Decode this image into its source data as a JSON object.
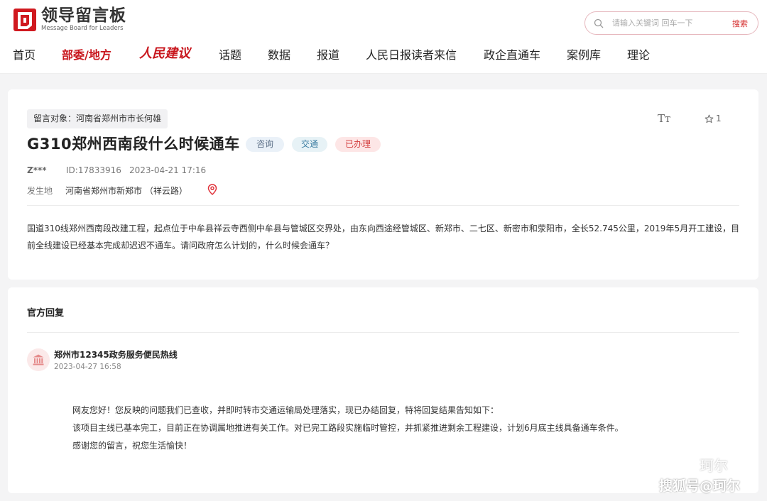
{
  "site": {
    "logo_cn": "领导留言板",
    "logo_en": "Message Board for Leaders"
  },
  "search": {
    "placeholder": "请输入关键词 回车一下",
    "button": "搜索"
  },
  "nav": {
    "items": [
      "首页",
      "部委/地方",
      "人民建议",
      "话题",
      "数据",
      "报道",
      "人民日报读者来信",
      "政企直通车",
      "案例库",
      "理论"
    ],
    "active_index": 1
  },
  "message": {
    "target": "留言对象：河南省郑州市市长何雄",
    "title": "G310郑州西南段什么时候通车",
    "tags": [
      "咨询",
      "交通",
      "已办理"
    ],
    "font_tool": "Tт",
    "favorite_count": "1",
    "user": "Z***",
    "id": "ID:17833916",
    "date": "2023-04-21 17:16",
    "location_label": "发生地",
    "location": "河南省郑州市新郑市 （祥云路）",
    "content": "国道310线郑州西南段改建工程，起点位于中牟县祥云寺西侧中牟县与管城区交界处，由东向西途经管城区、新郑市、二七区、新密市和荥阳市，全长52.745公里，2019年5月开工建设，目前全线建设已经基本完成却迟迟不通车。请问政府怎么计划的，什么时候会通车？"
  },
  "reply": {
    "section_title": "官方回复",
    "org": "郑州市12345政务服务便民热线",
    "date": "2023-04-27 16:58",
    "lines": [
      "网友您好！您反映的问题我们已查收，并即时转市交通运输局处理落实，现已办结回复，特将回复结果告知如下：",
      "该项目主线已基本完工，目前正在协调属地推进有关工作。对已完工路段实施临时管控，并抓紧推进剩余工程建设，计划6月底主线具备通车条件。",
      "感谢您的留言，祝您生活愉快！"
    ]
  },
  "watermark": {
    "line1": "珂尔",
    "line2": "搜狐号@珂尔"
  },
  "colors": {
    "brand_red": "#c8161d",
    "tag_done": "#d23c3c",
    "background": "#f4f4f5"
  }
}
